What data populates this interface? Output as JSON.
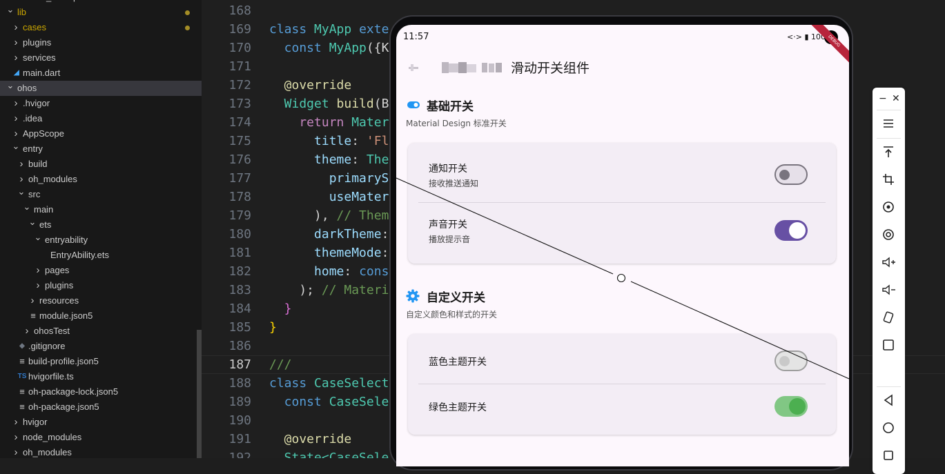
{
  "explorer": {
    "items": [
      {
        "label": "cases_examples",
        "type": "folder",
        "depth": 1,
        "expanded": false
      },
      {
        "label": "lib",
        "type": "folder",
        "depth": 0,
        "expanded": true,
        "modified": true,
        "color": "#cca700"
      },
      {
        "label": "cases",
        "type": "folder",
        "depth": 1,
        "expanded": false,
        "modified": true,
        "color": "#cca700"
      },
      {
        "label": "plugins",
        "type": "folder",
        "depth": 1,
        "expanded": false
      },
      {
        "label": "services",
        "type": "folder",
        "depth": 1,
        "expanded": false
      },
      {
        "label": "main.dart",
        "type": "dart",
        "depth": 1
      },
      {
        "label": "ohos",
        "type": "folder",
        "depth": 0,
        "expanded": true,
        "selected": true
      },
      {
        "label": ".hvigor",
        "type": "folder",
        "depth": 1,
        "expanded": false
      },
      {
        "label": ".idea",
        "type": "folder",
        "depth": 1,
        "expanded": false
      },
      {
        "label": "AppScope",
        "type": "folder",
        "depth": 1,
        "expanded": false
      },
      {
        "label": "entry",
        "type": "folder",
        "depth": 1,
        "expanded": true
      },
      {
        "label": "build",
        "type": "folder",
        "depth": 2,
        "expanded": false
      },
      {
        "label": "oh_modules",
        "type": "folder",
        "depth": 2,
        "expanded": false
      },
      {
        "label": "src",
        "type": "folder",
        "depth": 2,
        "expanded": true
      },
      {
        "label": "main",
        "type": "folder",
        "depth": 3,
        "expanded": true
      },
      {
        "label": "ets",
        "type": "folder",
        "depth": 4,
        "expanded": true
      },
      {
        "label": "entryability",
        "type": "folder",
        "depth": 5,
        "expanded": true
      },
      {
        "label": "EntryAbility.ets",
        "type": "ets",
        "depth": 6
      },
      {
        "label": "pages",
        "type": "folder",
        "depth": 5,
        "expanded": false
      },
      {
        "label": "plugins",
        "type": "folder",
        "depth": 5,
        "expanded": false
      },
      {
        "label": "resources",
        "type": "folder",
        "depth": 4,
        "expanded": false
      },
      {
        "label": "module.json5",
        "type": "json",
        "depth": 4
      },
      {
        "label": "ohosTest",
        "type": "folder",
        "depth": 3,
        "expanded": false
      },
      {
        "label": ".gitignore",
        "type": "git",
        "depth": 2
      },
      {
        "label": "build-profile.json5",
        "type": "json",
        "depth": 2
      },
      {
        "label": "hvigorfile.ts",
        "type": "ts",
        "depth": 2
      },
      {
        "label": "oh-package-lock.json5",
        "type": "json",
        "depth": 2
      },
      {
        "label": "oh-package.json5",
        "type": "json",
        "depth": 2
      },
      {
        "label": "hvigor",
        "type": "folder",
        "depth": 1,
        "expanded": false
      },
      {
        "label": "node_modules",
        "type": "folder",
        "depth": 1,
        "expanded": false
      },
      {
        "label": "oh_modules",
        "type": "folder",
        "depth": 1,
        "expanded": false
      }
    ]
  },
  "editor": {
    "current_line": 187,
    "lines": [
      {
        "n": "168",
        "tokens": []
      },
      {
        "n": "169",
        "tokens": [
          [
            "class ",
            "#569cd6"
          ],
          [
            "MyApp ",
            "#4ec9b0"
          ],
          [
            "exte",
            "#569cd6"
          ]
        ]
      },
      {
        "n": "170",
        "tokens": [
          [
            "  const ",
            "#569cd6"
          ],
          [
            "MyApp",
            "#4ec9b0"
          ],
          [
            "({K",
            "#d4d4d4"
          ]
        ]
      },
      {
        "n": "171",
        "tokens": []
      },
      {
        "n": "172",
        "tokens": [
          [
            "  @override",
            "#dcdcaa"
          ]
        ]
      },
      {
        "n": "173",
        "tokens": [
          [
            "  Widget ",
            "#4ec9b0"
          ],
          [
            "build",
            "#dcdcaa"
          ],
          [
            "(B",
            "#d4d4d4"
          ]
        ]
      },
      {
        "n": "174",
        "tokens": [
          [
            "    return ",
            "#c586c0"
          ],
          [
            "Mater",
            "#4ec9b0"
          ]
        ]
      },
      {
        "n": "175",
        "tokens": [
          [
            "      title",
            "#9cdcfe"
          ],
          [
            ": ",
            "#d4d4d4"
          ],
          [
            "'Fl",
            "#ce9178"
          ]
        ]
      },
      {
        "n": "176",
        "tokens": [
          [
            "      theme",
            "#9cdcfe"
          ],
          [
            ": ",
            "#d4d4d4"
          ],
          [
            "The",
            "#4ec9b0"
          ]
        ]
      },
      {
        "n": "177",
        "tokens": [
          [
            "        primaryS",
            "#9cdcfe"
          ]
        ]
      },
      {
        "n": "178",
        "tokens": [
          [
            "        useMater",
            "#9cdcfe"
          ]
        ]
      },
      {
        "n": "179",
        "tokens": [
          [
            "      ), ",
            "#d4d4d4"
          ],
          [
            "// Them",
            "#6a9955"
          ]
        ]
      },
      {
        "n": "180",
        "tokens": [
          [
            "      darkTheme",
            "#9cdcfe"
          ],
          [
            ":",
            "#d4d4d4"
          ]
        ]
      },
      {
        "n": "181",
        "tokens": [
          [
            "      themeMode",
            "#9cdcfe"
          ],
          [
            ":",
            "#d4d4d4"
          ]
        ]
      },
      {
        "n": "182",
        "tokens": [
          [
            "      home",
            "#9cdcfe"
          ],
          [
            ": ",
            "#d4d4d4"
          ],
          [
            "cons",
            "#569cd6"
          ]
        ]
      },
      {
        "n": "183",
        "tokens": [
          [
            "    ); ",
            "#d4d4d4"
          ],
          [
            "// Materi",
            "#6a9955"
          ]
        ]
      },
      {
        "n": "184",
        "tokens": [
          [
            "  }",
            "#da70d6"
          ]
        ]
      },
      {
        "n": "185",
        "tokens": [
          [
            "}",
            "#ffd700"
          ]
        ]
      },
      {
        "n": "186",
        "tokens": []
      },
      {
        "n": "187",
        "tokens": [
          [
            "///",
            "#6a9955"
          ]
        ]
      },
      {
        "n": "188",
        "tokens": [
          [
            "class ",
            "#569cd6"
          ],
          [
            "CaseSelect",
            "#4ec9b0"
          ]
        ]
      },
      {
        "n": "189",
        "tokens": [
          [
            "  const ",
            "#569cd6"
          ],
          [
            "CaseSele",
            "#4ec9b0"
          ]
        ]
      },
      {
        "n": "190",
        "tokens": []
      },
      {
        "n": "191",
        "tokens": [
          [
            "  @override",
            "#dcdcaa"
          ]
        ]
      },
      {
        "n": "192",
        "tokens": [
          [
            "  State<",
            "#4ec9b0"
          ],
          [
            "CaseSele",
            "#4ec9b0"
          ]
        ]
      }
    ]
  },
  "phone": {
    "status_time": "11:57",
    "status_icons": "<·> ▮ 100",
    "debug_ribbon": "DEBUG",
    "appbar_title": "滑动开关组件",
    "section1": {
      "title": "基础开关",
      "subtitle": "Material Design 标准开关",
      "rows": [
        {
          "title": "通知开关",
          "subtitle": "接收推送通知",
          "on": false
        },
        {
          "title": "声音开关",
          "subtitle": "播放提示音",
          "on": true
        }
      ]
    },
    "section2": {
      "title": "自定义开关",
      "subtitle": "自定义颜色和样式的开关",
      "rows": [
        {
          "title": "蓝色主题开关",
          "on": false
        },
        {
          "title": "绿色主题开关",
          "on": true
        }
      ]
    },
    "colors": {
      "accent": "#6750a4",
      "blue_icon": "#2196f3",
      "green": "#4caf50"
    }
  },
  "toolbar": {
    "minimize_label": "−",
    "close_label": "✕",
    "buttons": [
      "menu-icon",
      "top-icon",
      "crop-icon",
      "rotate-icon",
      "power-icon",
      "volume-up-icon",
      "volume-down-icon",
      "shake-icon",
      "square-icon",
      "back-icon",
      "home-icon",
      "recent-icon"
    ]
  }
}
